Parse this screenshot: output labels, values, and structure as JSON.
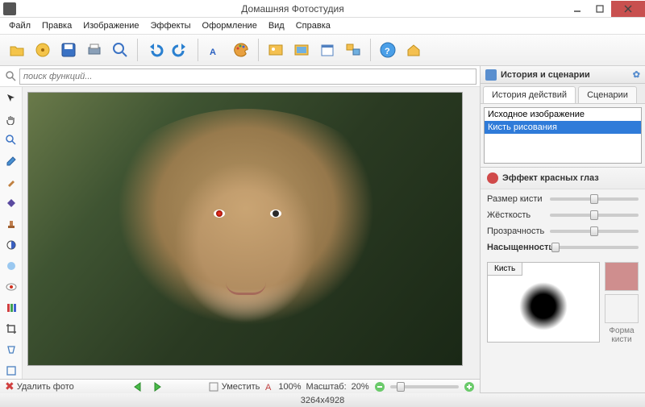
{
  "window": {
    "title": "Домашняя Фотостудия"
  },
  "menu": [
    "Файл",
    "Правка",
    "Изображение",
    "Эффекты",
    "Оформление",
    "Вид",
    "Справка"
  ],
  "search": {
    "placeholder": "поиск функций..."
  },
  "bottom": {
    "delete": "Удалить фото",
    "fit": "Уместить",
    "zoom100": "100%",
    "scale_label": "Масштаб:",
    "scale_value": "20%"
  },
  "right": {
    "panel_title": "История и сценарии",
    "tabs": {
      "history": "История действий",
      "scenarios": "Сценарии"
    },
    "history_items": [
      "Исходное изображение",
      "Кисть рисования"
    ],
    "effect_title": "Эффект красных глаз",
    "sliders": {
      "size": "Размер кисти",
      "hardness": "Жёсткость",
      "opacity": "Прозрачность",
      "saturation": "Насыщенность"
    },
    "brush_tab": "Кисть",
    "shape_label": "Форма кисти"
  },
  "status": "3264x4928"
}
